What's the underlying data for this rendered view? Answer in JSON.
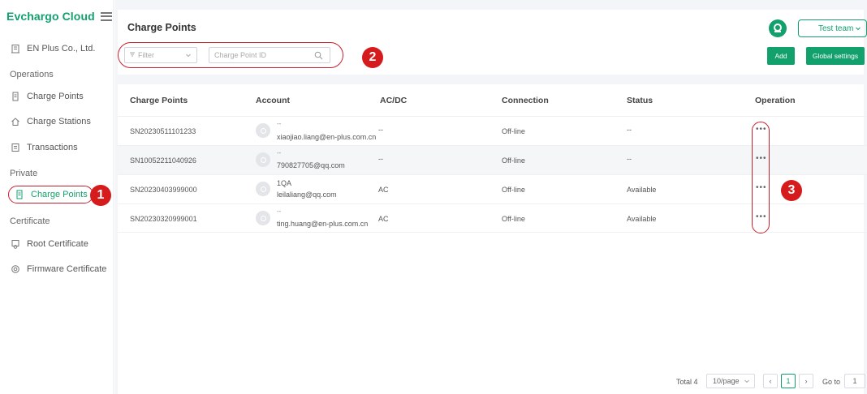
{
  "brand": {
    "name": "Evchargo Cloud"
  },
  "sidebar": {
    "company": "EN Plus Co., Ltd.",
    "sections": {
      "operations": "Operations",
      "private": "Private",
      "certificate": "Certificate"
    },
    "operations_items": [
      "Charge Points",
      "Charge Stations",
      "Transactions"
    ],
    "private_items": [
      "Charge Points"
    ],
    "certificate_items": [
      "Root Certificate",
      "Firmware Certificate"
    ]
  },
  "header": {
    "title": "Charge Points",
    "filter_placeholder": "Filter",
    "search_placeholder": "Charge Point ID",
    "team": "Test team",
    "add_label": "Add",
    "global_settings_label": "Global settings"
  },
  "badges": {
    "one": "1",
    "two": "2",
    "three": "3"
  },
  "table": {
    "columns": [
      "Charge Points",
      "Account",
      "AC/DC",
      "Connection",
      "Status",
      "Operation"
    ],
    "rows": [
      {
        "id": "SN20230511101233",
        "acct_name": "--",
        "acct_email": "xiaojiao.liang@en-plus.com.cn",
        "acdc": "--",
        "connection": "Off-line",
        "status": "--",
        "op": "•••"
      },
      {
        "id": "SN10052211040926",
        "acct_name": "--",
        "acct_email": "790827705@qq.com",
        "acdc": "--",
        "connection": "Off-line",
        "status": "--",
        "op": "•••"
      },
      {
        "id": "SN20230403999000",
        "acct_name": "1QA",
        "acct_email": "leilaliang@qq.com",
        "acdc": "AC",
        "connection": "Off-line",
        "status": "Available",
        "op": "•••"
      },
      {
        "id": "SN20230320999001",
        "acct_name": "--",
        "acct_email": "ting.huang@en-plus.com.cn",
        "acdc": "AC",
        "connection": "Off-line",
        "status": "Available",
        "op": "•••"
      }
    ]
  },
  "pagination": {
    "total": "Total 4",
    "page_size": "10/page",
    "prev": "‹",
    "current": "1",
    "next": "›",
    "goto_label": "Go to",
    "goto_value": "1"
  },
  "colors": {
    "brand_green": "#12a06d",
    "annotation_red": "#d51b1b"
  },
  "icons": {
    "company": "building-icon",
    "charge_points": "charger-icon",
    "charge_stations": "home-icon",
    "transactions": "receipt-icon",
    "root_cert": "certificate-icon",
    "firmware_cert": "gear-icon"
  }
}
